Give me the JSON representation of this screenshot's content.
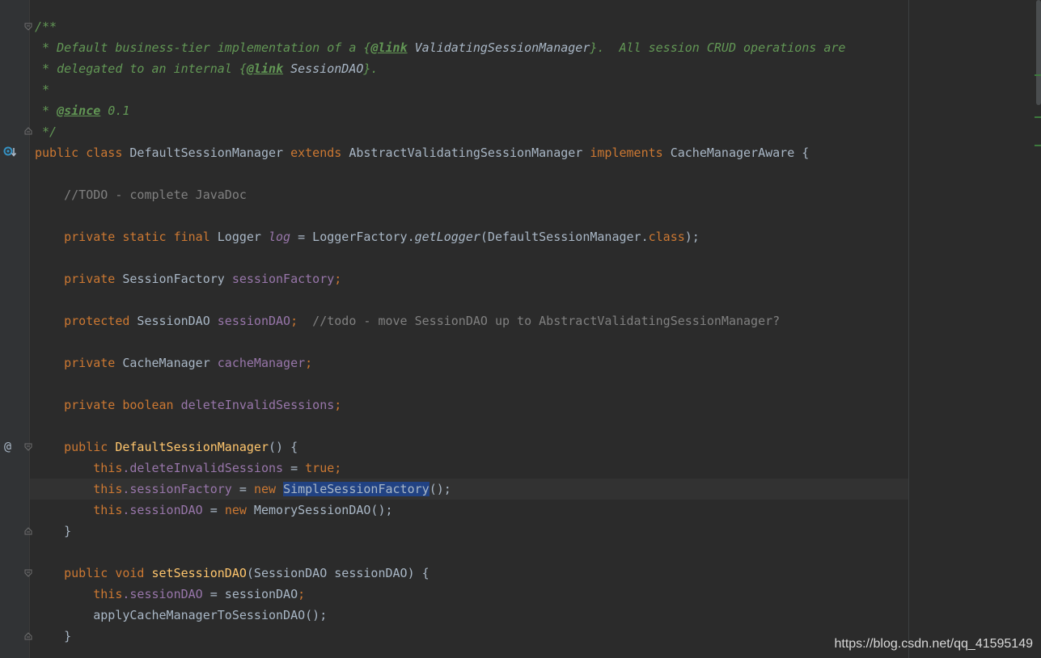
{
  "code": {
    "doc_open": "/**",
    "doc_l1_a": " * Default business-tier implementation of a {",
    "doc_l1_link": "@link",
    "doc_l1_ref": " ValidatingSessionManager",
    "doc_l1_b": "}.  All session CRUD operations are",
    "doc_l2_a": " * delegated to an internal {",
    "doc_l2_link": "@link",
    "doc_l2_ref": " SessionDAO",
    "doc_l2_b": "}.",
    "doc_l3": " *",
    "doc_l4_a": " * ",
    "doc_since": "@since",
    "doc_ver": " 0.1",
    "doc_close": " */",
    "cls_public": "public",
    "cls_class": "class",
    "cls_name": "DefaultSessionManager",
    "cls_extends": "extends",
    "cls_super": "AbstractValidatingSessionManager",
    "cls_implements": "implements",
    "cls_iface": "CacheManagerAware",
    "cls_brace": " {",
    "todo": "//TODO - complete JavaDoc",
    "log_mods": "private static final",
    "log_type": " Logger ",
    "log_name": "log",
    "log_eq": " = LoggerFactory.",
    "log_call": "getLogger",
    "log_arg": "(DefaultSessionManager.",
    "log_class": "class",
    "log_end": ");",
    "sf_mod": "private",
    "sf_type": " SessionFactory ",
    "sf_name": "sessionFactory",
    "sf_semi": ";",
    "sd_mod": "protected",
    "sd_type": " SessionDAO ",
    "sd_name": "sessionDAO",
    "sd_semi": ";",
    "sd_comment": "  //todo - move SessionDAO up to AbstractValidatingSessionManager?",
    "cm_mod": "private",
    "cm_type": " CacheManager ",
    "cm_name": "cacheManager",
    "cm_semi": ";",
    "di_mod": "private boolean",
    "di_name": " deleteInvalidSessions",
    "di_semi": ";",
    "ctor_mod": "public",
    "ctor_name": " DefaultSessionManager",
    "ctor_rest": "() {",
    "b1_this": "this",
    "b1_field": ".deleteInvalidSessions",
    "b1_eq": " = ",
    "b1_val": "true",
    "b1_semi": ";",
    "b2_this": "this",
    "b2_field": ".sessionFactory",
    "b2_eq": " = ",
    "b2_new": "new",
    "b2_sp": " ",
    "b2_sel": "SimpleSessionFactory",
    "b2_end": "();",
    "b3_this": "this",
    "b3_field": ".sessionDAO",
    "b3_eq": " = ",
    "b3_new": "new",
    "b3_rest": " MemorySessionDAO();",
    "close1": "}",
    "m_mod": "public void",
    "m_name": " setSessionDAO",
    "m_rest": "(SessionDAO sessionDAO) {",
    "m1_this": "this",
    "m1_field": ".sessionDAO",
    "m1_rest": " = sessionDAO",
    "m1_semi": ";",
    "m2": "applyCacheManagerToSessionDAO();",
    "close2": "}"
  },
  "gutter": {
    "override_icon": "implemented-method-icon",
    "annotation_glyph": "@"
  },
  "watermark": "https://blog.csdn.net/qq_41595149"
}
